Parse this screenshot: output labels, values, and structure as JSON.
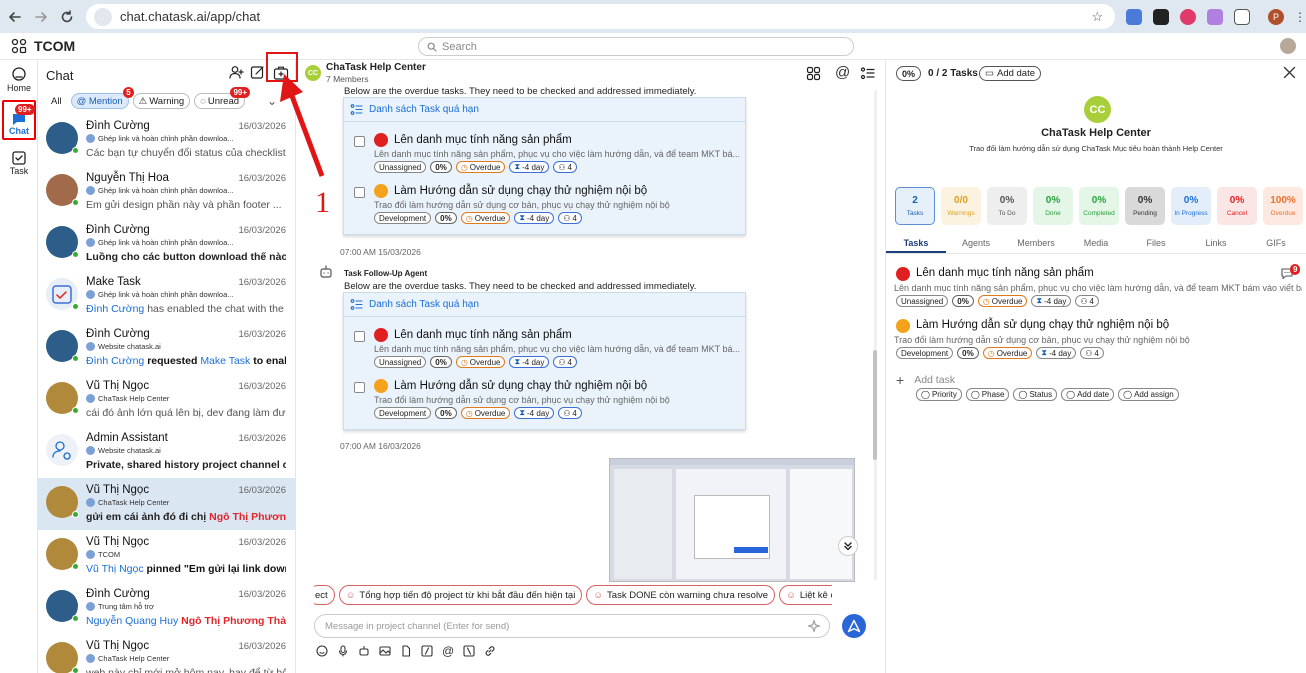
{
  "browser": {
    "url": "chat.chatask.ai/app/chat",
    "profile": "P"
  },
  "app": {
    "name": "TCOM",
    "search_placeholder": "Search"
  },
  "rail": {
    "home": "Home",
    "chat": "Chat",
    "chat_badge": "99+",
    "task": "Task"
  },
  "list": {
    "title": "Chat",
    "filters": {
      "all": "All",
      "mention": "@ Mention",
      "mention_badge": "5",
      "warning": "Warning",
      "unread": "Unread",
      "unread_badge": "99+"
    },
    "conversations": [
      {
        "name": "Đình Cường",
        "date": "16/03/2026",
        "sub": "Ghép link và hoàn chỉnh phần downloa...",
        "msg": "Các bạn tự chuyển đổi status của checklist ite...",
        "color": "#2d5e8a"
      },
      {
        "name": "Nguyễn Thị Hoa",
        "date": "16/03/2026",
        "sub": "Ghép link và hoàn chỉnh phần downloa...",
        "msg": "Em gửi design phần này và phần footer ...",
        "color": "#a06a4b"
      },
      {
        "name": "Đình Cường",
        "date": "16/03/2026",
        "sub": "Ghép link và hoàn chỉnh phần downloa...",
        "msg": "Luồng cho các button download thế nào dc...",
        "color": "#2d5e8a"
      },
      {
        "name": "Make Task",
        "date": "16/03/2026",
        "sub": "Ghép link và hoàn chỉnh phần downloa...",
        "msg_a": "Đình Cường",
        "msg_b": " has enabled the chat with the inf...",
        "color": "#e8eef7"
      },
      {
        "name": "Đình Cường",
        "date": "16/03/2026",
        "sub": "Website chatask.ai",
        "msg_a": "Đình Cường",
        "msg_b": " requested ",
        "msg_c": "Make Task",
        "msg_d": " to enabl...",
        "color": "#2d5e8a"
      },
      {
        "name": "Vũ Thị Ngọc",
        "date": "16/03/2026",
        "sub": "ChaTask Help Center",
        "msg": "cái đó ảnh lớn quá lên bị, dev đang làm đưa ra t...",
        "color": "#b08a3a"
      },
      {
        "name": "Admin Assistant",
        "date": "16/03/2026",
        "sub": "Website chatask.ai",
        "msg": "Private, shared history project channel cre...",
        "color": "#eef2f8"
      },
      {
        "name": "Vũ Thị Ngọc",
        "date": "16/03/2026",
        "sub": "ChaTask Help Center",
        "msg_a": "gửi em cái ảnh đó đi chị ",
        "msg_b": "Ngô Thị Phương Thả...",
        "color": "#b08a3a"
      },
      {
        "name": "Vũ Thị Ngọc",
        "date": "16/03/2026",
        "sub": "TCOM",
        "msg_a": "Vũ Thị Ngọc",
        "msg_b": " pinned \"Em gửi lại link downloa...",
        "color": "#b08a3a"
      },
      {
        "name": "Đình Cường",
        "date": "16/03/2026",
        "sub": "Trung tâm hỗ trợ",
        "msg_a": "Nguyễn Quang Huy",
        "msg_b": " Ngô Thị Phương Thảo",
        "color": "#2d5e8a"
      },
      {
        "name": "Vũ Thị Ngọc",
        "date": "16/03/2026",
        "sub": "ChaTask Help Center",
        "msg": "web này chỉ mới mở hôm nay, hay để từ hôm n...",
        "color": "#b08a3a"
      }
    ]
  },
  "chat": {
    "avatar": "CC",
    "title": "ChaTask Help Center",
    "members": "7 Members",
    "intro1": "Below are the overdue tasks. They need to be checked and addressed immediately.",
    "card_title": "Danh sách Task quá hạn",
    "time1": "07:00 AM 15/03/2026",
    "agent": "Task Follow-Up Agent",
    "intro2": "Below are the overdue tasks. They need to be checked and addressed immediately.",
    "time2": "07:00 AM 16/03/2026",
    "tasks": [
      {
        "title": "Lên danh mục tính năng sản phẩm",
        "desc": "Lên danh mục tính năng sản phẩm, phục vụ cho việc làm hướng dẫn, và để team MKT bá...",
        "t1": "Unassigned",
        "pct": "0%",
        "od": "Overdue",
        "days": "-4 day",
        "cnt": "4"
      },
      {
        "title": "Làm Hướng dẫn sử dụng chạy thử nghiệm nội bộ",
        "desc": "Trao đổi làm hướng dẫn sử dụng cơ bản, phục vụ chạy thử nghiệm nội bộ",
        "t1": "Development",
        "pct": "0%",
        "od": "Overdue",
        "days": "-4 day",
        "cnt": "4"
      }
    ],
    "suggestions": [
      "ect",
      "Tổng hợp tiến độ project từ khi bắt đầu đến hiện tại",
      "Task DONE còn warning chưa resolve",
      "Liệt kê các tasl"
    ],
    "input_placeholder": "Message in project channel (Enter for send)"
  },
  "right": {
    "pct": "0%",
    "count": "0 / 2 Tasks",
    "add_date": "Add date",
    "avatar": "CC",
    "name": "ChaTask Help Center",
    "desc": "Trao đổi làm hướng dẫn sử dụng ChaTask Mục tiêu hoàn thành Help Center",
    "stats": [
      {
        "n": "2",
        "l": "Tasks",
        "fg": "#1b5fb3",
        "bg": "#e6f0fb",
        "bd": "#5a8fd6"
      },
      {
        "n": "0/0",
        "l": "Warnings",
        "fg": "#e0a020",
        "bg": "#fbf3e0",
        "bd": "#fbf3e0"
      },
      {
        "n": "0%",
        "l": "To Do",
        "fg": "#555",
        "bg": "#eeeeee",
        "bd": "#eeeeee"
      },
      {
        "n": "0%",
        "l": "Done",
        "fg": "#2aa040",
        "bg": "#e4f6e6",
        "bd": "#e4f6e6"
      },
      {
        "n": "0%",
        "l": "Completed",
        "fg": "#2aa040",
        "bg": "#e4f6e6",
        "bd": "#e4f6e6"
      },
      {
        "n": "0%",
        "l": "Pending",
        "fg": "#333",
        "bg": "#d9d9d9",
        "bd": "#d9d9d9"
      },
      {
        "n": "0%",
        "l": "In Progress",
        "fg": "#1b6fd6",
        "bg": "#e4eefb",
        "bd": "#e4eefb"
      },
      {
        "n": "0%",
        "l": "Cancel",
        "fg": "#e02020",
        "bg": "#fbe6e6",
        "bd": "#fbe6e6"
      },
      {
        "n": "100%",
        "l": "Overdue",
        "fg": "#f07030",
        "bg": "#fde9e0",
        "bd": "#fde9e0"
      }
    ],
    "tabs": [
      "Tasks",
      "Agents",
      "Members",
      "Media",
      "Files",
      "Links",
      "GIFs"
    ],
    "tasks": [
      {
        "title": "Lên danh mục tính năng sản phẩm",
        "desc": "Lên danh mục tính năng sản phẩm, phục vụ cho việc làm hướng dẫn, và để team MKT bám vào viết bài",
        "t1": "Unassigned",
        "pct": "0%",
        "od": "Overdue",
        "days": "-4 day",
        "cnt": "4"
      },
      {
        "title": "Làm Hướng dẫn sử dụng chạy thử nghiệm nội bộ",
        "desc": "Trao đổi làm hướng dẫn sử dụng cơ bản, phục vụ chạy thử nghiệm nội bộ",
        "t1": "Development",
        "pct": "0%",
        "od": "Overdue",
        "days": "-4 day",
        "cnt": "4"
      }
    ],
    "comment_badge": "9",
    "add_task": "Add task",
    "chips": [
      "Priority",
      "Phase",
      "Status",
      "Add date",
      "Add assign"
    ]
  },
  "annotation": {
    "number": "1"
  }
}
